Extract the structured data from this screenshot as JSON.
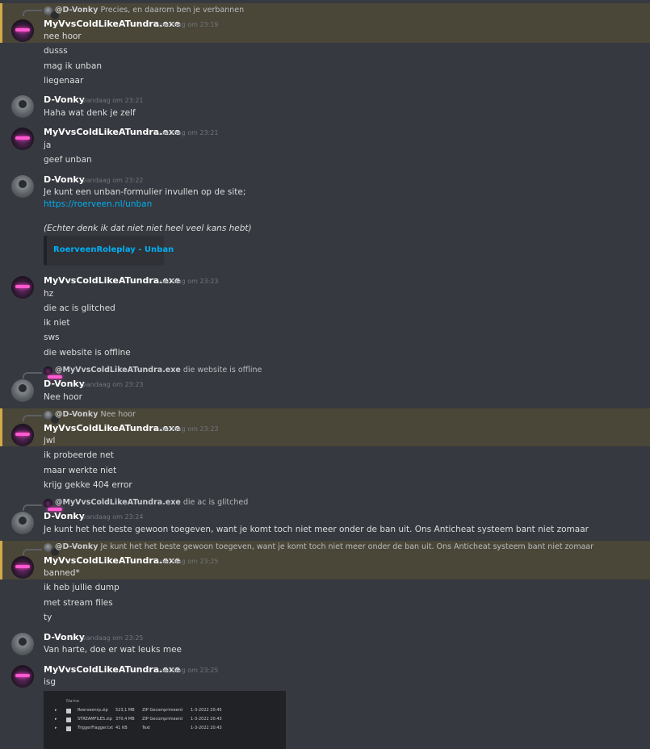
{
  "names": {
    "mv": "MyVvsColdLikeATundra.exe",
    "dv": "D-Vonky"
  },
  "ts": {
    "t2319": "vandaag om 23:19",
    "t2321": "vandaag om 23:21",
    "t2322": "vandaag om 23:22",
    "t2323": "vandaag om 23:23",
    "t2324": "vandaag om 23:24",
    "t2325": "vandaag om 23:25"
  },
  "replies": {
    "r1_name": "@D-Vonky",
    "r1_text": "Precies, en daarom ben je verbannen",
    "r2_name": "@MyVvsColdLikeATundra.exe",
    "r2_text": "die website is offline",
    "r3_name": "@D-Vonky",
    "r3_text": "Nee hoor",
    "r4_name": "@MyVvsColdLikeATundra.exe",
    "r4_text": "die ac is glitched",
    "r5_name": "@D-Vonky",
    "r5_text": "Je kunt het het beste gewoon toegeven, want je komt toch niet meer onder de ban uit. Ons Anticheat systeem bant niet zomaar"
  },
  "messages": {
    "m1": [
      "nee hoor",
      "dusss",
      "mag ik unban",
      "liegenaar"
    ],
    "m2": [
      "Haha wat denk je zelf"
    ],
    "m3": [
      "ja",
      "geef unban"
    ],
    "m4": {
      "line1": "Je kunt een unban-formulier invullen op de site;",
      "link": "https://roerveen.nl/unban",
      "italic": "(Echter denk ik dat niet niet heel veel kans hebt)",
      "embed_title": "RoerveenRoleplay - Unban"
    },
    "m5": [
      "hz",
      "die ac is glitched",
      "ik niet",
      "sws",
      "die website is offline"
    ],
    "m6": [
      "Nee hoor"
    ],
    "m7": [
      "jwl",
      "ik probeerde net",
      "maar werkte niet",
      "krijg gekke 404 error"
    ],
    "m8": [
      "Je kunt het het beste gewoon toegeven, want je komt toch niet meer onder de ban uit. Ons Anticheat systeem bant niet zomaar"
    ],
    "m9": [
      "banned*",
      "ik heb jullie dump",
      "met stream files",
      "ty"
    ],
    "m10": [
      "Van harte, doe er wat leuks mee"
    ],
    "m11": [
      "isg"
    ]
  },
  "attachment": {
    "header": "Name",
    "files": [
      {
        "name": "Roerveenrp.zip",
        "size": "523,1 MB",
        "type": "ZIP Gecomprimeerd",
        "date": "1-3-2022 20:45"
      },
      {
        "name": "STREAMFILES.zip",
        "size": "370,4 MB",
        "type": "ZIP Gecomprimeerd",
        "date": "1-3-2022 20:43"
      },
      {
        "name": "TriggerFlagger.txt",
        "size": "41 KB",
        "type": "Text",
        "date": "1-3-2022 20:43"
      }
    ]
  }
}
